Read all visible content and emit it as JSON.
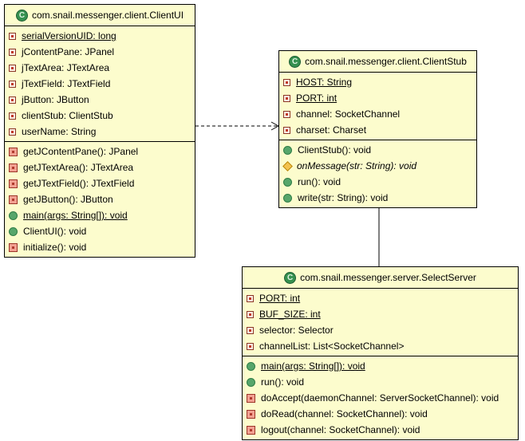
{
  "diagram": {
    "class_icon_letter": "C",
    "classes": [
      {
        "id": "clientui",
        "title": "com.snail.messenger.client.ClientUI",
        "fields": [
          {
            "text": "serialVersionUID: long",
            "icon": "private-field",
            "static": true
          },
          {
            "text": "jContentPane: JPanel",
            "icon": "private-field"
          },
          {
            "text": "jTextArea: JTextArea",
            "icon": "private-field"
          },
          {
            "text": "jTextField: JTextField",
            "icon": "private-field"
          },
          {
            "text": "jButton: JButton",
            "icon": "private-field"
          },
          {
            "text": "clientStub: ClientStub",
            "icon": "private-field"
          },
          {
            "text": "userName: String",
            "icon": "private-field"
          }
        ],
        "methods": [
          {
            "text": "getJContentPane(): JPanel",
            "icon": "private-method"
          },
          {
            "text": "getJTextArea(): JTextArea",
            "icon": "private-method"
          },
          {
            "text": "getJTextField(): JTextField",
            "icon": "private-method"
          },
          {
            "text": "getJButton(): JButton",
            "icon": "private-method"
          },
          {
            "text": "main(args: String[]): void",
            "icon": "public-method",
            "static": true
          },
          {
            "text": "ClientUI(): void",
            "icon": "public-method"
          },
          {
            "text": "initialize(): void",
            "icon": "private-method"
          }
        ]
      },
      {
        "id": "clientstub",
        "title": "com.snail.messenger.client.ClientStub",
        "fields": [
          {
            "text": "HOST: String",
            "icon": "private-field",
            "static": true
          },
          {
            "text": "PORT: int",
            "icon": "private-field",
            "static": true
          },
          {
            "text": "channel: SocketChannel",
            "icon": "private-field"
          },
          {
            "text": "charset: Charset",
            "icon": "private-field"
          }
        ],
        "methods": [
          {
            "text": "ClientStub(): void",
            "icon": "public-method"
          },
          {
            "text": "onMessage(str: String): void",
            "icon": "protected-method",
            "abstract": true
          },
          {
            "text": "run(): void",
            "icon": "public-method"
          },
          {
            "text": "write(str: String): void",
            "icon": "public-method"
          }
        ]
      },
      {
        "id": "selectserver",
        "title": "com.snail.messenger.server.SelectServer",
        "fields": [
          {
            "text": "PORT: int",
            "icon": "private-field",
            "static": true
          },
          {
            "text": "BUF_SIZE: int",
            "icon": "private-field",
            "static": true
          },
          {
            "text": "selector: Selector",
            "icon": "private-field"
          },
          {
            "text": "channelList: List<SocketChannel>",
            "icon": "private-field"
          }
        ],
        "methods": [
          {
            "text": "main(args: String[]): void",
            "icon": "public-method",
            "static": true
          },
          {
            "text": "run(): void",
            "icon": "public-method"
          },
          {
            "text": "doAccept(daemonChannel: ServerSocketChannel): void",
            "icon": "private-method"
          },
          {
            "text": "doRead(channel: SocketChannel): void",
            "icon": "private-method"
          },
          {
            "text": "logout(channel: SocketChannel): void",
            "icon": "private-method"
          }
        ]
      }
    ],
    "connectors": [
      {
        "type": "dependency",
        "style": "dashed-open-arrow",
        "from": "ClientUI",
        "to": "ClientStub"
      },
      {
        "type": "association",
        "style": "solid-line",
        "from": "ClientStub",
        "to": "SelectServer"
      }
    ]
  },
  "colors": {
    "page-bg": "#ffffff",
    "box-fill": "#fcfccd",
    "line-color": "#000000",
    "text-color": "#000000",
    "class-icon-green": "#36914f",
    "class-icon-rim": "#1c5c33",
    "class-icon-letter": "#dff3e2",
    "field-rim": "#8b3626",
    "field-fill": "#fdf0e3",
    "field-dot": "#c0392b",
    "pm-rim": "#9c3428",
    "pm-fill": "#f2a192",
    "pm-dot": "#b03a2e",
    "pub-rim": "#2f7d46",
    "pub-fill": "#57a66b",
    "prot-rim": "#b8860b",
    "prot-fill": "#f3c24f"
  }
}
